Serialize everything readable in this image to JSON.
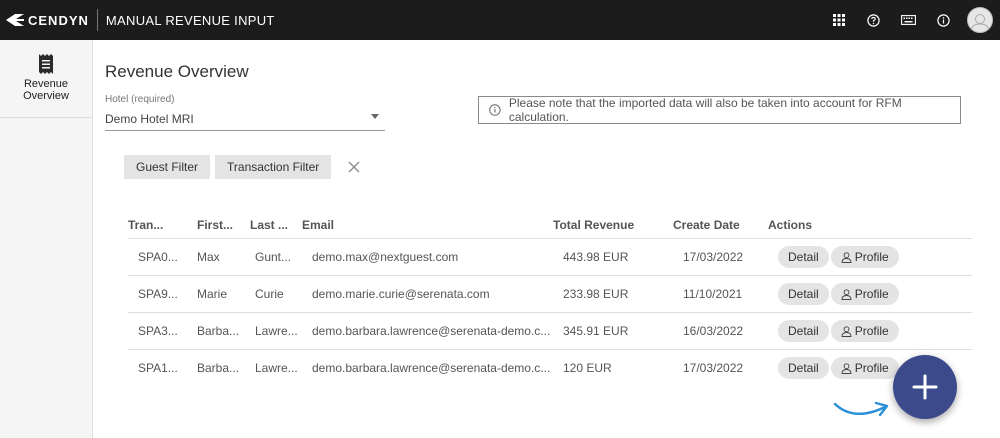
{
  "header": {
    "brand": "CENDYN",
    "app_title": "MANUAL REVENUE INPUT",
    "icons": [
      "apps-grid-icon",
      "help-icon",
      "keyboard-icon",
      "info-icon",
      "user-avatar"
    ]
  },
  "sidebar": {
    "items": [
      {
        "label": "Revenue Overview",
        "icon": "receipt-icon"
      }
    ]
  },
  "page": {
    "title": "Revenue Overview",
    "hotel_label": "Hotel (required)",
    "hotel_value": "Demo Hotel MRI",
    "notice": "Please note that the imported data will also be taken into account for RFM calculation."
  },
  "filters": {
    "guest": "Guest Filter",
    "transaction": "Transaction Filter"
  },
  "table": {
    "columns": [
      "Tran...",
      "First...",
      "Last ...",
      "Email",
      "Total Revenue",
      "Create Date",
      "Actions"
    ],
    "rows": [
      {
        "transaction": "SPA0...",
        "first": "Max",
        "last": "Gunt...",
        "email": "demo.max@nextguest.com",
        "revenue": "443.98 EUR",
        "date": "17/03/2022"
      },
      {
        "transaction": "SPA9...",
        "first": "Marie",
        "last": "Curie",
        "email": "demo.marie.curie@serenata.com",
        "revenue": "233.98 EUR",
        "date": "11/10/2021"
      },
      {
        "transaction": "SPA3...",
        "first": "Barba...",
        "last": "Lawre...",
        "email": "demo.barbara.lawrence@serenata-demo.c...",
        "revenue": "345.91 EUR",
        "date": "16/03/2022"
      },
      {
        "transaction": "SPA1...",
        "first": "Barba...",
        "last": "Lawre...",
        "email": "demo.barbara.lawrence@serenata-demo.c...",
        "revenue": "120 EUR",
        "date": "17/03/2022"
      }
    ],
    "detail_label": "Detail",
    "profile_label": "Profile"
  },
  "colors": {
    "topbar": "#1c1c1c",
    "fab": "#3c4a8c",
    "arrow": "#2a8fd6"
  }
}
